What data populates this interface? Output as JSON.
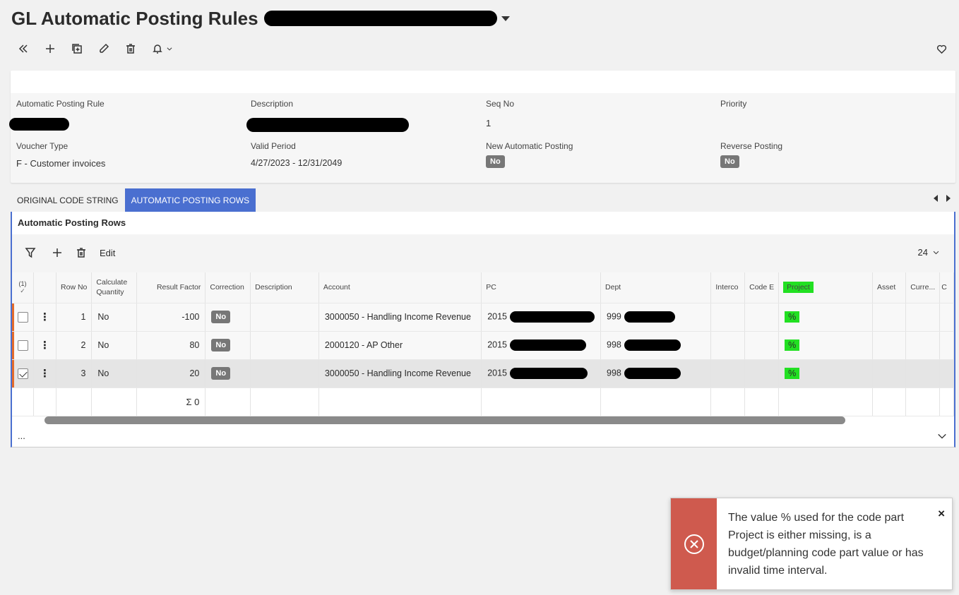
{
  "header": {
    "title": "GL Automatic Posting Rules"
  },
  "toolbar": {
    "icons": [
      "double-chevron-left-icon",
      "plus-icon",
      "duplicate-icon",
      "pencil-icon",
      "trash-icon",
      "bell-icon",
      "chevron-down-icon",
      "heart-icon"
    ]
  },
  "form": {
    "automatic_posting_rule": {
      "label": "Automatic Posting Rule"
    },
    "description": {
      "label": "Description"
    },
    "seq_no": {
      "label": "Seq No",
      "value": "1"
    },
    "priority": {
      "label": "Priority",
      "value": ""
    },
    "voucher_type": {
      "label": "Voucher Type",
      "value": "F - Customer invoices"
    },
    "valid_period": {
      "label": "Valid Period",
      "value": "4/27/2023 - 12/31/2049"
    },
    "new_automatic_posting": {
      "label": "New Automatic Posting",
      "value": "No"
    },
    "reverse_posting": {
      "label": "Reverse Posting",
      "value": "No"
    }
  },
  "tabs": [
    {
      "label": "ORIGINAL CODE STRING",
      "active": false
    },
    {
      "label": "AUTOMATIC POSTING ROWS",
      "active": true
    }
  ],
  "panel": {
    "title": "Automatic Posting Rows",
    "edit_label": "Edit",
    "page_size": "24",
    "footer_more": "..."
  },
  "grid": {
    "selected_count": "(1)",
    "columns": {
      "row_no": "Row No",
      "calc_qty_1": "Calculate",
      "calc_qty_2": "Quantity",
      "result_factor": "Result Factor",
      "correction": "Correction",
      "description": "Description",
      "account": "Account",
      "pc": "PC",
      "dept": "Dept",
      "interco": "Interco",
      "code_e": "Code E",
      "project": "Project",
      "asset": "Asset",
      "currency": "Curre...",
      "more": "C"
    },
    "rows": [
      {
        "row_no": "1",
        "calc_qty": "No",
        "result_factor": "-100",
        "correction": "No",
        "description": "",
        "account": "3000050 - Handling Income Revenue",
        "pc": "2015",
        "dept": "999",
        "project": "%"
      },
      {
        "row_no": "2",
        "calc_qty": "No",
        "result_factor": "80",
        "correction": "No",
        "description": "",
        "account": "2000120 - AP Other",
        "pc": "2015",
        "dept": "998",
        "project": "%"
      },
      {
        "row_no": "3",
        "calc_qty": "No",
        "result_factor": "20",
        "correction": "No",
        "description": "",
        "account": "3000050 - Handling Income Revenue",
        "pc": "2015",
        "dept": "998",
        "project": "%"
      }
    ],
    "sum": "Σ 0"
  },
  "toast": {
    "message": "The value % used for the code part Project is either missing, is a budget/planning code part value or has invalid time interval.",
    "close": "×"
  },
  "colors": {
    "accent": "#4a6fd0",
    "toast_error": "#cf5a4e",
    "highlight": "#22e022",
    "row_marker": "#e36b2b"
  }
}
